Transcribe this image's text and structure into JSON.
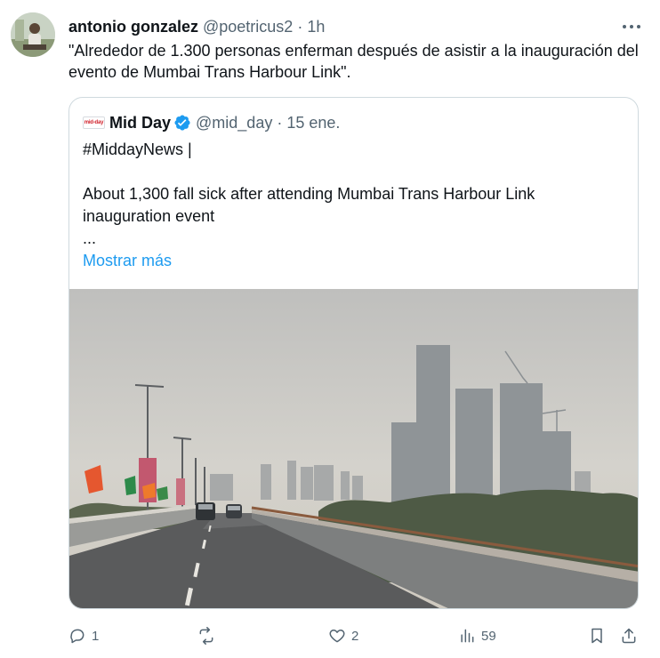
{
  "author": {
    "name": "antonio gonzalez",
    "handle": "@poetricus2",
    "separator": "·",
    "time": "1h"
  },
  "tweet": {
    "text": "\"Alrededor de 1.300 personas enferman después de asistir a la inauguración del evento de Mumbai Trans Harbour Link\"."
  },
  "quote": {
    "logo_text": "mid-day",
    "name": "Mid Day",
    "handle": "@mid_day",
    "separator": "·",
    "date": "15 ene.",
    "line1": "#MiddayNews |",
    "line2": "About 1,300 fall sick after attending Mumbai Trans Harbour Link inauguration event",
    "line3": "...",
    "show_more": "Mostrar más"
  },
  "actions": {
    "reply_count": "1",
    "repost_count": "",
    "like_count": "2",
    "views_count": "59"
  },
  "colors": {
    "link": "#1d9bf0",
    "secondary": "#536471",
    "verified": "#1d9bf0",
    "border": "#cfd9de"
  }
}
